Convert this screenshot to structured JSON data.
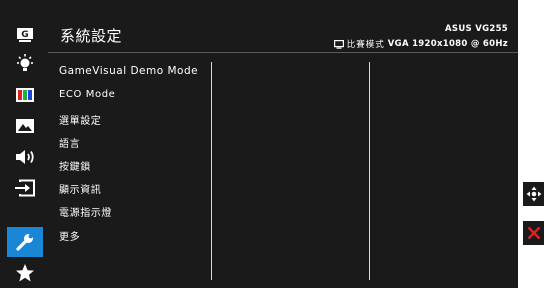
{
  "header": {
    "title": "系統設定",
    "model": "ASUS VG255",
    "mode_label": "比賽模式",
    "resolution": "VGA 1920x1080 @ 60Hz"
  },
  "sidebar": {
    "badge_letter": "G",
    "items": [
      {
        "icon": "gamevisual-icon"
      },
      {
        "icon": "brightness-icon"
      },
      {
        "icon": "color-icon"
      },
      {
        "icon": "image-icon"
      },
      {
        "icon": "sound-icon"
      },
      {
        "icon": "input-select-icon"
      },
      {
        "icon": "system-setup-icon",
        "active": true
      },
      {
        "icon": "favorite-star-icon"
      }
    ]
  },
  "menu": {
    "items": [
      {
        "label": "GameVisual Demo Mode"
      },
      {
        "label": "ECO Mode"
      },
      {
        "label": "選單設定"
      },
      {
        "label": "語言"
      },
      {
        "label": "按鍵鎖"
      },
      {
        "label": "顯示資訊"
      },
      {
        "label": "電源指示燈"
      },
      {
        "label": "更多"
      }
    ]
  },
  "side_buttons": [
    {
      "icon": "navigation-joystick-icon"
    },
    {
      "icon": "close-icon"
    }
  ],
  "colors": {
    "panel": "#1a1a1a",
    "active": "#1a86d6",
    "close": "#e02020"
  }
}
